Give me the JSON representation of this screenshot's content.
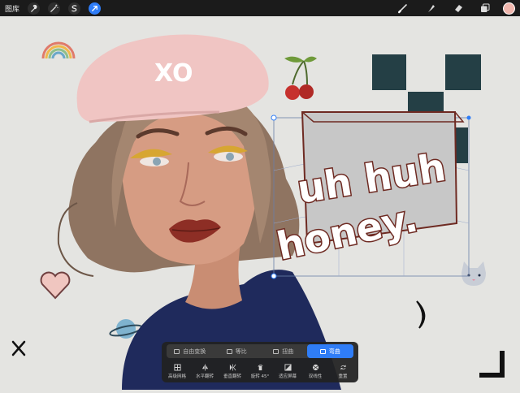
{
  "toolbar": {
    "gallery_label": "图库",
    "left_tools": [
      "wrench-icon",
      "magic-wand-icon",
      "selection-icon",
      "transform-arrow-icon"
    ],
    "right_tools": [
      "brush-icon",
      "smudge-icon",
      "eraser-icon",
      "layers-icon",
      "color-icon"
    ],
    "active_color": "#f0b7ae",
    "accent_color": "#2f7df7"
  },
  "artwork": {
    "lettering_line1": "uh huh",
    "lettering_line2": "honey.",
    "beret_text": "XO"
  },
  "transform_panel": {
    "modes": [
      {
        "label": "自由变换",
        "active": false
      },
      {
        "label": "等比",
        "active": false
      },
      {
        "label": "扭曲",
        "active": false
      },
      {
        "label": "弯曲",
        "active": true
      }
    ],
    "actions": [
      {
        "label": "高级网格",
        "icon": "grid-icon"
      },
      {
        "label": "水平翻转",
        "icon": "flip-horizontal-icon"
      },
      {
        "label": "垂直翻转",
        "icon": "flip-vertical-icon"
      },
      {
        "label": "旋转 45°",
        "icon": "rotate-icon"
      },
      {
        "label": "适应屏幕",
        "icon": "fit-screen-icon"
      },
      {
        "label": "双线性",
        "icon": "bilinear-icon"
      },
      {
        "label": "重置",
        "icon": "reset-icon"
      }
    ]
  }
}
